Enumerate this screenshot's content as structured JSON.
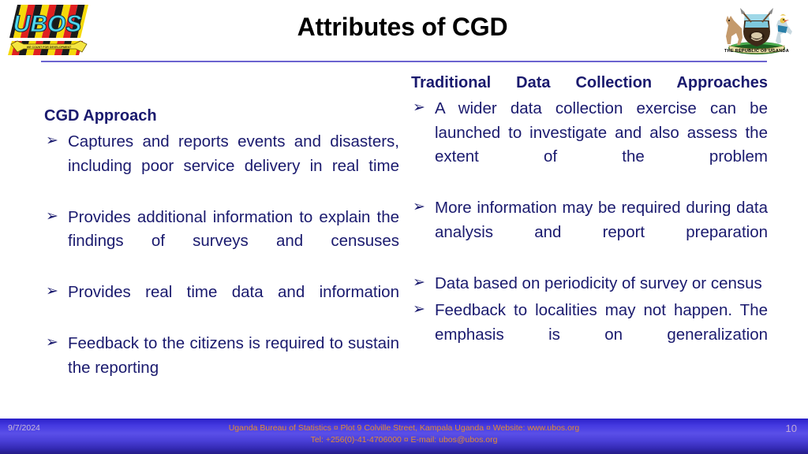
{
  "header": {
    "title": "Attributes of CGD",
    "logo_left": {
      "name": "ubos-logo",
      "text": "UBOS",
      "ribbon_text": "WE COUNT FOR DEVELOPMENT",
      "colors": {
        "stripe_black": "#1a1a1a",
        "stripe_yellow": "#f5d90a",
        "stripe_red": "#e02020",
        "letters": "#4fd8f0",
        "ribbon": "#f5e642"
      }
    },
    "logo_right": {
      "name": "uganda-coat-of-arms",
      "caption": "THE REPUBLIC  OF UGANDA"
    },
    "rule_color": "#6b63cf"
  },
  "columns": [
    {
      "id": "cgd-approach",
      "heading": "CGD Approach",
      "bullet_glyph": "➢",
      "bullets": [
        "Captures and reports events and disasters, including poor service delivery in real time",
        "Provides additional information to explain the findings of surveys and censuses",
        "Provides real time data and information",
        "Feedback to the citizens is required to sustain the reporting"
      ]
    },
    {
      "id": "traditional-approaches",
      "heading": "Traditional Data Collection Approaches",
      "bullet_glyph": "➢",
      "bullets": [
        "A wider data collection exercise can be launched to investigate and also assess the extent of the problem",
        "More information may be required during data analysis and report preparation",
        "Data based on periodicity of survey or census",
        "Feedback to localities may not happen. The emphasis is on generalization"
      ]
    }
  ],
  "footer": {
    "date": "9/7/2024",
    "line1": "Uganda Bureau of Statistics ¤ Plot 9 Colville Street, Kampala Uganda ¤ Website: www.ubos.org",
    "line2": "Tel: +256(0)-41-4706000 ¤ E-mail: ubos@ubos.org",
    "page_number": "10",
    "text_color": "#e08a32",
    "background": "#4338e0"
  },
  "text_color": "#1a1a6e"
}
